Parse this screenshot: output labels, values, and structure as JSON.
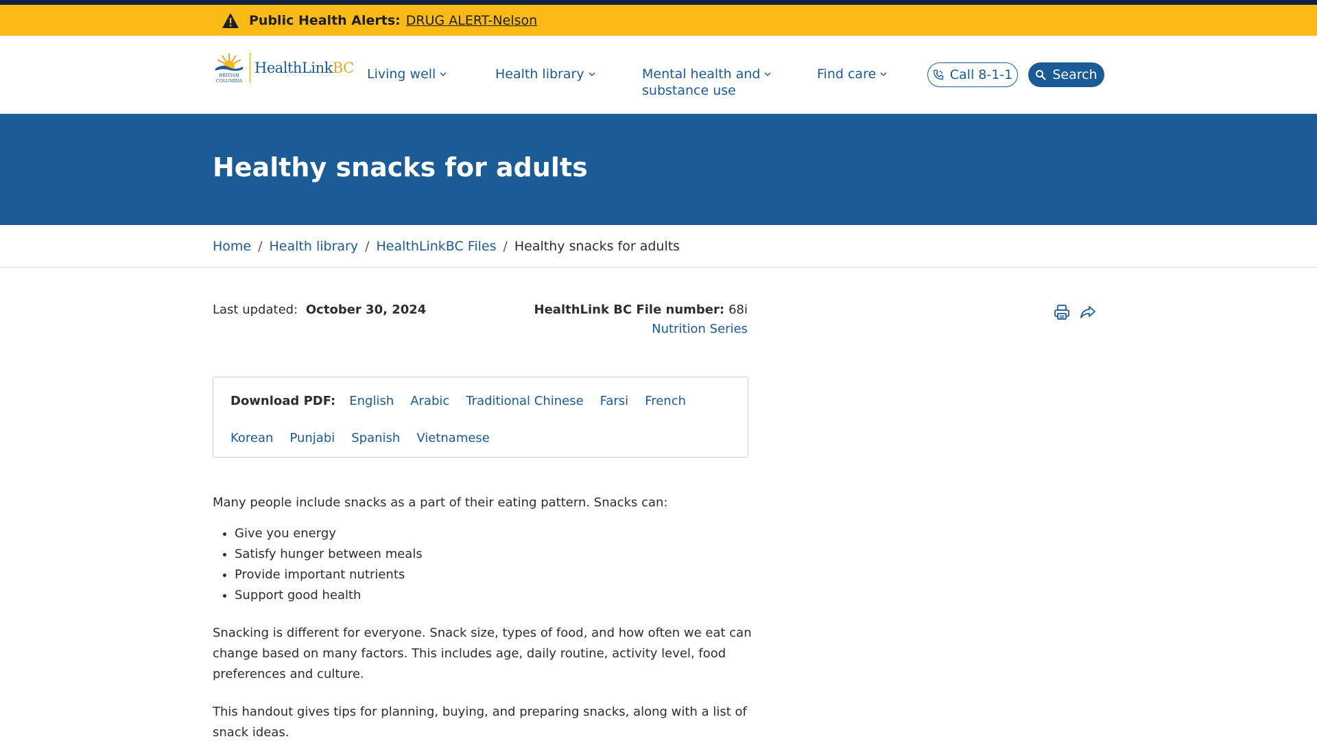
{
  "alert": {
    "label": "Public Health Alerts:",
    "link": "DRUG ALERT-Nelson"
  },
  "logo": {
    "province_line1": "BRITISH",
    "province_line2": "COLUMBIA",
    "name_main": "HealthLink",
    "name_accent": "BC"
  },
  "nav": {
    "items": [
      {
        "label": "Living well"
      },
      {
        "label": "Health library"
      },
      {
        "label_line1": "Mental health and",
        "label_line2": "substance use"
      },
      {
        "label": "Find care"
      }
    ],
    "call_label": "Call 8-1-1",
    "search_label": "Search"
  },
  "hero": {
    "title": "Healthy snacks for adults"
  },
  "breadcrumb": {
    "items": [
      "Home",
      "Health library",
      "HealthLinkBC Files"
    ],
    "current": "Healthy snacks for adults"
  },
  "meta": {
    "updated_label": "Last updated:",
    "updated_value": "October 30, 2024",
    "file_label": "HealthLink BC File number:",
    "file_value": "68i",
    "series": "Nutrition Series"
  },
  "pdf": {
    "label": "Download PDF:",
    "languages": [
      "English",
      "Arabic",
      "Traditional Chinese",
      "Farsi",
      "French",
      "Korean",
      "Punjabi",
      "Spanish",
      "Vietnamese"
    ]
  },
  "content": {
    "intro": "Many people include snacks as a part of their eating pattern. Snacks can:",
    "bullets": [
      "Give you energy",
      "Satisfy hunger between meals",
      "Provide important nutrients",
      "Support good health"
    ],
    "p2": "Snacking is different for everyone. Snack size, types of food, and how often we eat can change based on many factors. This includes age, daily routine, activity level, food preferences and culture.",
    "p3": "This handout gives tips for planning, buying, and preparing snacks, along with a list of snack ideas."
  },
  "colors": {
    "alert_bg": "#fcba19",
    "brand_blue": "#1a5a96",
    "hero_bg": "#1b5b96",
    "top_stripe": "#12233f"
  },
  "icons": [
    "warning-icon",
    "chevron-down-icon",
    "phone-icon",
    "search-icon",
    "print-icon",
    "share-icon"
  ]
}
